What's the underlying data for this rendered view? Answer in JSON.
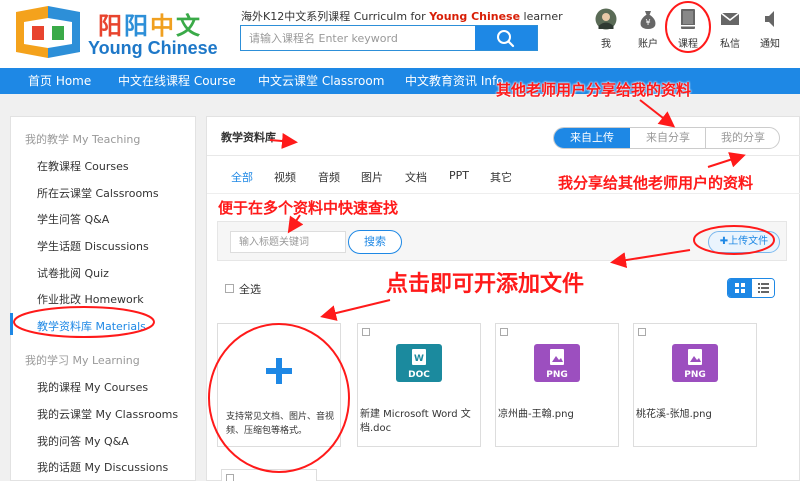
{
  "header": {
    "logo_cn": [
      "阳",
      "阳",
      "中",
      "文"
    ],
    "logo_en": "Young Chinese",
    "slogan_prefix": "海外K12中文系列课程 Curriculm for ",
    "slogan_highlight": "Young Chinese",
    "slogan_suffix": " learner",
    "search_placeholder": "请输入课程名 Enter keyword",
    "icons": [
      {
        "label": "我",
        "icon": "avatar-icon"
      },
      {
        "label": "账户",
        "icon": "money-bag-icon"
      },
      {
        "label": "课程",
        "icon": "book-icon"
      },
      {
        "label": "私信",
        "icon": "mail-icon"
      },
      {
        "label": "通知",
        "icon": "speaker-icon"
      }
    ]
  },
  "nav": {
    "items": [
      "首页 Home",
      "中文在线课程 Course",
      "中文云课堂 Classroom",
      "中文教育资讯 Info"
    ]
  },
  "sidebar": {
    "teaching_head": "我的教学 My Teaching",
    "teaching_items": [
      "在教课程 Courses",
      "所在云课堂 Calssrooms",
      "学生问答 Q&A",
      "学生话题 Discussions",
      "试卷批阅 Quiz",
      "作业批改 Homework",
      "教学资料库 Materials"
    ],
    "learning_head": "我的学习 My Learning",
    "learning_items": [
      "我的课程 My Courses",
      "我的云课堂 My Classrooms",
      "我的问答 My Q&A",
      "我的话题 My Discussions"
    ]
  },
  "main": {
    "title": "教学资料库",
    "segments": [
      "来自上传",
      "来自分享",
      "我的分享"
    ],
    "filter_tabs": [
      "全部",
      "视频",
      "音频",
      "图片",
      "文档",
      "PPT",
      "其它"
    ],
    "keyword_placeholder": "输入标题关键词",
    "search_label": "搜索",
    "upload_label": "上传文件",
    "select_all_label": "全选",
    "add_card_desc": "支持常见文档、图片、音视频、压缩包等格式。",
    "files": [
      {
        "name": "新建 Microsoft Word 文档.doc",
        "type": "DOC",
        "color": "#1b8a9e"
      },
      {
        "name": "凉州曲-王翰.png",
        "type": "PNG",
        "color": "#9c4fbf"
      },
      {
        "name": "桃花溪-张旭.png",
        "type": "PNG",
        "color": "#9c4fbf"
      }
    ]
  },
  "annotations": {
    "shared_to_me": "其他老师用户分享给我的资料",
    "my_shared": "我分享给其他老师用户的资料",
    "quick_find": "便于在多个资料中快速查找",
    "click_add": "点击即可开添加文件"
  },
  "colors": {
    "primary": "#1e88e5",
    "annotation": "#ff1a1a"
  }
}
